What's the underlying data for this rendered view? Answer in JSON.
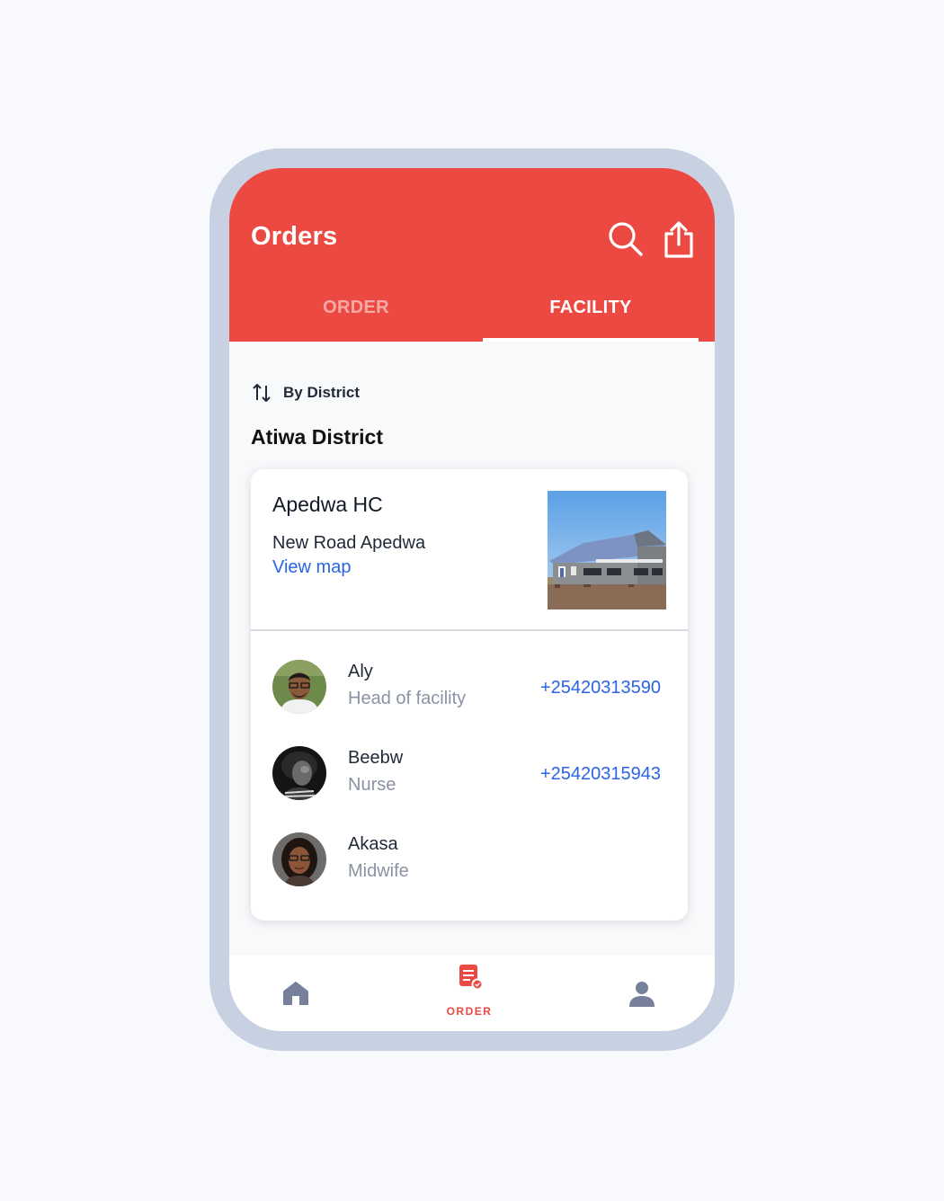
{
  "header": {
    "title": "Orders",
    "icons": [
      "search-icon",
      "share-icon"
    ],
    "background": "#ec4942"
  },
  "tabs": [
    {
      "label": "ORDER",
      "active": false
    },
    {
      "label": "FACILITY",
      "active": true
    }
  ],
  "sort": {
    "label": "By District",
    "icon": "sort-arrows-icon"
  },
  "district": {
    "title": "Atiwa District"
  },
  "facility": {
    "name": "Apedwa HC",
    "address": "New Road Apedwa",
    "map_link": "View map"
  },
  "staff": [
    {
      "name": "Aly",
      "role": "Head of facility",
      "phone": "+25420313590"
    },
    {
      "name": "Beebw",
      "role": "Nurse",
      "phone": "+25420315943"
    },
    {
      "name": "Akasa",
      "role": "Midwife",
      "phone": ""
    }
  ],
  "bottom_nav": {
    "items": [
      {
        "icon": "home-icon",
        "label": ""
      },
      {
        "icon": "order-icon",
        "label": "ORDER",
        "active": true
      },
      {
        "icon": "profile-icon",
        "label": ""
      }
    ]
  },
  "colors": {
    "accent": "#ec4942",
    "link": "#2b63e6",
    "muted": "#8a93a6"
  }
}
